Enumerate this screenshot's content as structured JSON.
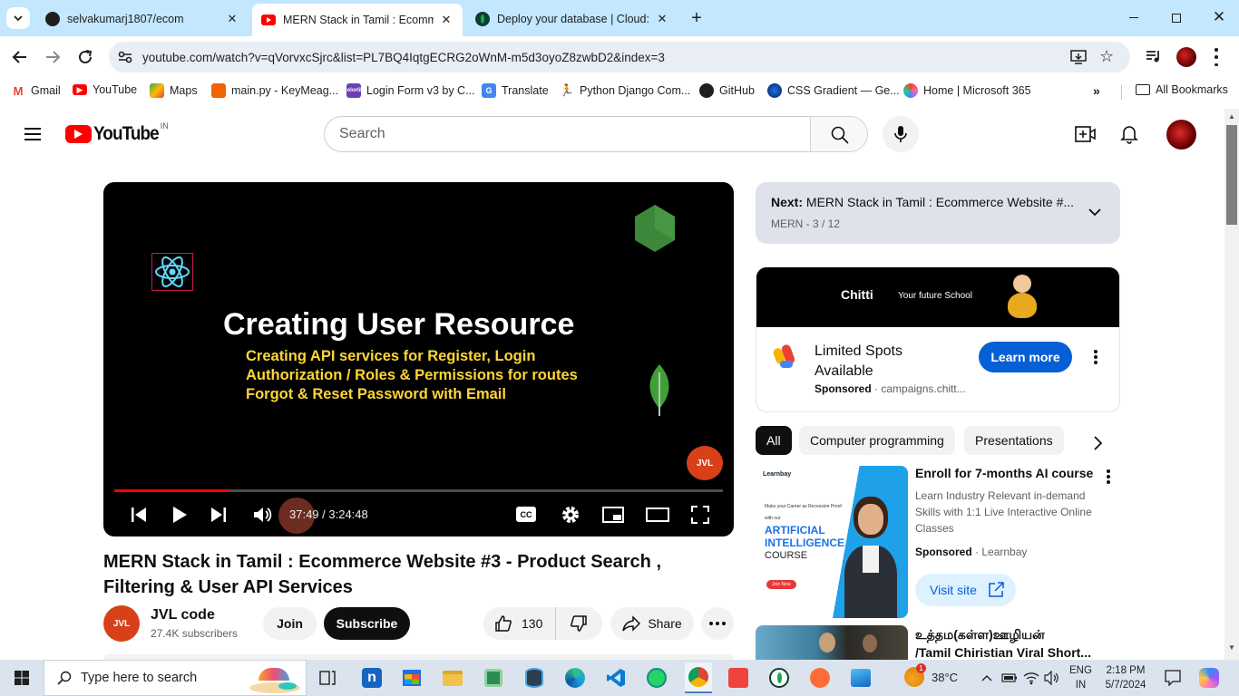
{
  "browser": {
    "tabs": [
      {
        "title": "selvakumarj1807/ecom",
        "icon": "github-icon"
      },
      {
        "title": "MERN Stack in Tamil : Ecommerce",
        "icon": "youtube-icon"
      },
      {
        "title": "Deploy your database | Cloud: M",
        "icon": "mongodb-icon"
      }
    ],
    "url": "youtube.com/watch?v=qVorvxcSjrc&list=PL7BQ4IqtgECRG2oWnM-m5d3oyoZ8zwbD2&index=3",
    "bookmarks": [
      "Gmail",
      "YouTube",
      "Maps",
      "main.py - KeyMeag...",
      "Login Form v3 by C...",
      "Translate",
      "Python Django Com...",
      "GitHub",
      "CSS Gradient — Ge...",
      "Home | Microsoft 365"
    ],
    "all_bookmarks": "All Bookmarks"
  },
  "yt": {
    "logo": "YouTube",
    "region": "IN",
    "search_placeholder": "Search"
  },
  "video": {
    "slide_title": "Creating User Resource",
    "slide_lines": [
      "Creating API services for Register, Login",
      "Authorization / Roles & Permissions for routes",
      "Forgot & Reset Password with Email"
    ],
    "watermark": "JVL",
    "time": "37:49 / 3:24:48",
    "progress": 0.19,
    "title": "MERN Stack in Tamil : Ecommerce Website #3 - Product Search , Filtering & User API Services",
    "channel": "JVL code",
    "subscribers": "27.4K subscribers",
    "join": "Join",
    "subscribe": "Subscribe",
    "likes": "130",
    "share": "Share"
  },
  "playlist": {
    "next_label": "Next:",
    "next_title": "MERN Stack in Tamil : Ecommerce Website  #...",
    "meta": "MERN - 3 / 12"
  },
  "ad1": {
    "banner_brand": "Chitti",
    "banner_tagline": "Your future School",
    "title": "Limited Spots Available",
    "sponsored": "Sponsored",
    "domain": "campaigns.chitt...",
    "cta": "Learn more"
  },
  "chips": [
    "All",
    "Computer programming",
    "Presentations"
  ],
  "ad2": {
    "thumb_brand": "Learnbay",
    "thumb_kicker": "Make your Career as Recession Proof",
    "thumb_with": "with our",
    "thumb_line1": "ARTIFICIAL",
    "thumb_line2": "INTELLIGENCE",
    "thumb_line3": "COURSE",
    "thumb_join": "Join Now",
    "title": "Enroll for 7-months AI course",
    "desc": "Learn Industry Relevant in-demand Skills with 1:1 Live Interactive Online Classes",
    "sponsored": "Sponsored",
    "advertiser": "Learnbay",
    "cta": "Visit site"
  },
  "rec": {
    "title_line1": "உத்தம(கள்ள)ஊழியன்",
    "title_line2": "/Tamil Chiristian Viral Short..."
  },
  "taskbar": {
    "search": "Type here to search",
    "weather": "38°C",
    "weather_badge": "1",
    "lang1": "ENG",
    "lang2": "IN",
    "time": "2:18 PM",
    "date": "5/7/2024"
  },
  "colors": {
    "tabbar": "#c2e7ff",
    "yt_red": "#ff0000",
    "blue_cta": "#065fd4",
    "slide_yellow": "#ffd633"
  }
}
